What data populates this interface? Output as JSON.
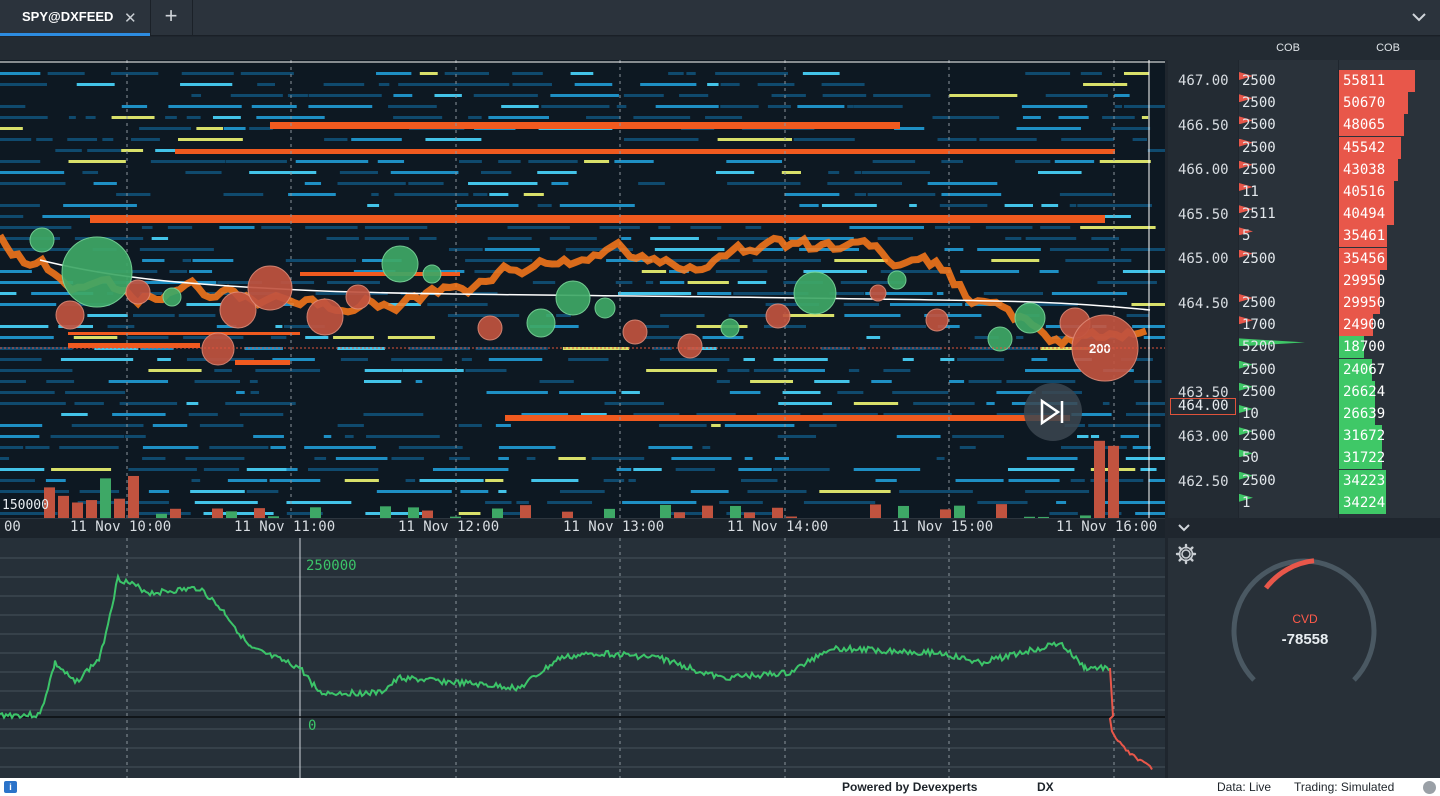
{
  "tabs": [
    {
      "label": "SPY@DXFEED",
      "active": true
    }
  ],
  "tab_icons": {
    "close": "close-icon",
    "add": "plus-icon",
    "menu": "chevron-down-icon"
  },
  "heatmap": {
    "volume_label": "150000",
    "time_ticks": [
      "00",
      "11 Nov 10:00",
      "11 Nov 11:00",
      "11 Nov 12:00",
      "11 Nov 13:00",
      "11 Nov 14:00",
      "11 Nov 15:00",
      "11 Nov 16:00"
    ],
    "trade_bubble_label": "200",
    "play_icon": "skip-forward-icon"
  },
  "price_axis": {
    "labels": [
      "467.00",
      "466.50",
      "466.00",
      "465.50",
      "465.00",
      "464.50",
      "464.00",
      "463.50",
      "463.00",
      "462.50"
    ],
    "current": "464.00"
  },
  "cob": {
    "left_header": "COB",
    "right_header": "COB",
    "left_values": [
      "2500",
      "2500",
      "2500",
      "2500",
      "2500",
      "11",
      "2511",
      "5",
      "2500",
      "",
      "2500",
      "1700",
      "5200",
      "2500",
      "2500",
      "10",
      "2500",
      "50",
      "2500",
      "1"
    ],
    "right_values": [
      "55811",
      "50670",
      "48065",
      "45542",
      "43038",
      "40516",
      "40494",
      "35461",
      "35456",
      "29950",
      "29950",
      "24900",
      "18700",
      "24067",
      "26624",
      "26639",
      "31672",
      "31722",
      "34223",
      "34224"
    ],
    "ask_color": "#e8574a",
    "bid_color": "#3fc867"
  },
  "cvd": {
    "axis_top_label": "250000",
    "axis_zero_label": "0",
    "gauge_title": "CVD",
    "gauge_value": "-78558",
    "line_color": "#3cc469",
    "negative_color": "#e8574a"
  },
  "statusbar": {
    "powered_by": "Powered by Devexperts",
    "dx": "DX",
    "data": "Data: Live",
    "trading": "Trading: Simulated"
  }
}
